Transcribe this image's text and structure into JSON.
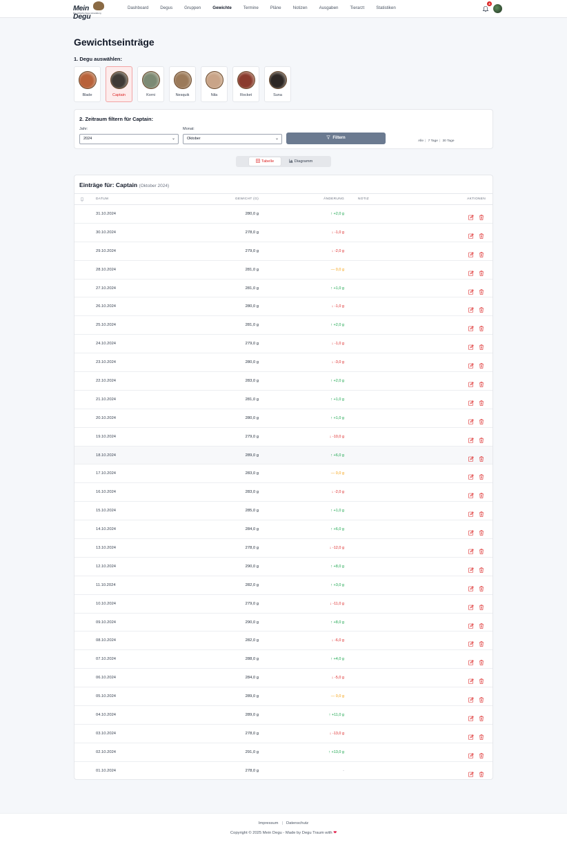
{
  "nav": {
    "logo": "Mein Degu",
    "logo_sub": "Die einfache Degu-Verwaltung",
    "links": [
      "Dashboard",
      "Degus",
      "Gruppen",
      "Gewichte",
      "Termine",
      "Pläne",
      "Notizen",
      "Ausgaben",
      "Tierarzt",
      "Statistiken"
    ],
    "active": "Gewichte",
    "notification_count": "4"
  },
  "page": {
    "title": "Gewichtseinträge",
    "section1_label": "1. Degu auswählen:"
  },
  "degus": [
    {
      "name": "Blade",
      "color": "#b8623a"
    },
    {
      "name": "Captain",
      "color": "#3f3a36",
      "active": true
    },
    {
      "name": "Korni",
      "color": "#7c8a74"
    },
    {
      "name": "Nesquik",
      "color": "#9b7a5a"
    },
    {
      "name": "Nila",
      "color": "#c9a488"
    },
    {
      "name": "Rocket",
      "color": "#8a3b2e"
    },
    {
      "name": "Suna",
      "color": "#2d2724"
    }
  ],
  "filter": {
    "title": "2. Zeitraum filtern für Captain:",
    "year_label": "Jahr:",
    "year_value": "2024",
    "month_label": "Monat:",
    "month_value": "Oktober",
    "button_label": "Filtern",
    "quick": [
      "Alle",
      "7 Tage",
      "30 Tage"
    ]
  },
  "view_toggle": {
    "table_label": "Tabelle",
    "chart_label": "Diagramm",
    "active": "table"
  },
  "table": {
    "title": "Einträge für: Captain",
    "subtitle": "(Oktober 2024)",
    "headers": {
      "date": "DATUM",
      "weight": "GEWICHT (G)",
      "change": "ÄNDERUNG",
      "note": "NOTIZ",
      "actions": "AKTIONEN"
    },
    "rows": [
      {
        "date": "31.10.2024",
        "weight": "280,0 g",
        "change": "+2,0 g",
        "trend": "up"
      },
      {
        "date": "30.10.2024",
        "weight": "278,0 g",
        "change": "-1,0 g",
        "trend": "down"
      },
      {
        "date": "29.10.2024",
        "weight": "279,0 g",
        "change": "-2,0 g",
        "trend": "down"
      },
      {
        "date": "28.10.2024",
        "weight": "281,0 g",
        "change": "0,0 g",
        "trend": "zero"
      },
      {
        "date": "27.10.2024",
        "weight": "281,0 g",
        "change": "+1,0 g",
        "trend": "up"
      },
      {
        "date": "26.10.2024",
        "weight": "280,0 g",
        "change": "-1,0 g",
        "trend": "down"
      },
      {
        "date": "25.10.2024",
        "weight": "281,0 g",
        "change": "+2,0 g",
        "trend": "up"
      },
      {
        "date": "24.10.2024",
        "weight": "279,0 g",
        "change": "-1,0 g",
        "trend": "down"
      },
      {
        "date": "23.10.2024",
        "weight": "280,0 g",
        "change": "-3,0 g",
        "trend": "down"
      },
      {
        "date": "22.10.2024",
        "weight": "283,0 g",
        "change": "+2,0 g",
        "trend": "up"
      },
      {
        "date": "21.10.2024",
        "weight": "281,0 g",
        "change": "+1,0 g",
        "trend": "up"
      },
      {
        "date": "20.10.2024",
        "weight": "280,0 g",
        "change": "+1,0 g",
        "trend": "up"
      },
      {
        "date": "19.10.2024",
        "weight": "279,0 g",
        "change": "-10,0 g",
        "trend": "down"
      },
      {
        "date": "18.10.2024",
        "weight": "289,0 g",
        "change": "+6,0 g",
        "trend": "up",
        "highlight": true
      },
      {
        "date": "17.10.2024",
        "weight": "283,0 g",
        "change": "0,0 g",
        "trend": "zero"
      },
      {
        "date": "16.10.2024",
        "weight": "283,0 g",
        "change": "-2,0 g",
        "trend": "down"
      },
      {
        "date": "15.10.2024",
        "weight": "285,0 g",
        "change": "+1,0 g",
        "trend": "up"
      },
      {
        "date": "14.10.2024",
        "weight": "284,0 g",
        "change": "+6,0 g",
        "trend": "up"
      },
      {
        "date": "13.10.2024",
        "weight": "278,0 g",
        "change": "-12,0 g",
        "trend": "down"
      },
      {
        "date": "12.10.2024",
        "weight": "290,0 g",
        "change": "+8,0 g",
        "trend": "up"
      },
      {
        "date": "11.10.2024",
        "weight": "282,0 g",
        "change": "+3,0 g",
        "trend": "up"
      },
      {
        "date": "10.10.2024",
        "weight": "279,0 g",
        "change": "-11,0 g",
        "trend": "down"
      },
      {
        "date": "09.10.2024",
        "weight": "290,0 g",
        "change": "+8,0 g",
        "trend": "up"
      },
      {
        "date": "08.10.2024",
        "weight": "282,0 g",
        "change": "-6,0 g",
        "trend": "down"
      },
      {
        "date": "07.10.2024",
        "weight": "288,0 g",
        "change": "+4,0 g",
        "trend": "up"
      },
      {
        "date": "06.10.2024",
        "weight": "284,0 g",
        "change": "-5,0 g",
        "trend": "down"
      },
      {
        "date": "05.10.2024",
        "weight": "289,0 g",
        "change": "0,0 g",
        "trend": "zero"
      },
      {
        "date": "04.10.2024",
        "weight": "289,0 g",
        "change": "+11,0 g",
        "trend": "up"
      },
      {
        "date": "03.10.2024",
        "weight": "278,0 g",
        "change": "-13,0 g",
        "trend": "down"
      },
      {
        "date": "02.10.2024",
        "weight": "291,0 g",
        "change": "+13,0 g",
        "trend": "up"
      },
      {
        "date": "01.10.2024",
        "weight": "278,0 g",
        "change": "-",
        "trend": "none"
      }
    ]
  },
  "footer": {
    "impressum": "Impressum",
    "datenschutz": "Datenschutz",
    "copyright": "Copyright © 2025 Mein Degu - Made by Degu Traum with"
  },
  "colors": {
    "accent": "#dc2626",
    "up": "#16a34a",
    "down": "#dc2626",
    "zero": "#f59e0b",
    "filter_button": "#6b7a90"
  }
}
